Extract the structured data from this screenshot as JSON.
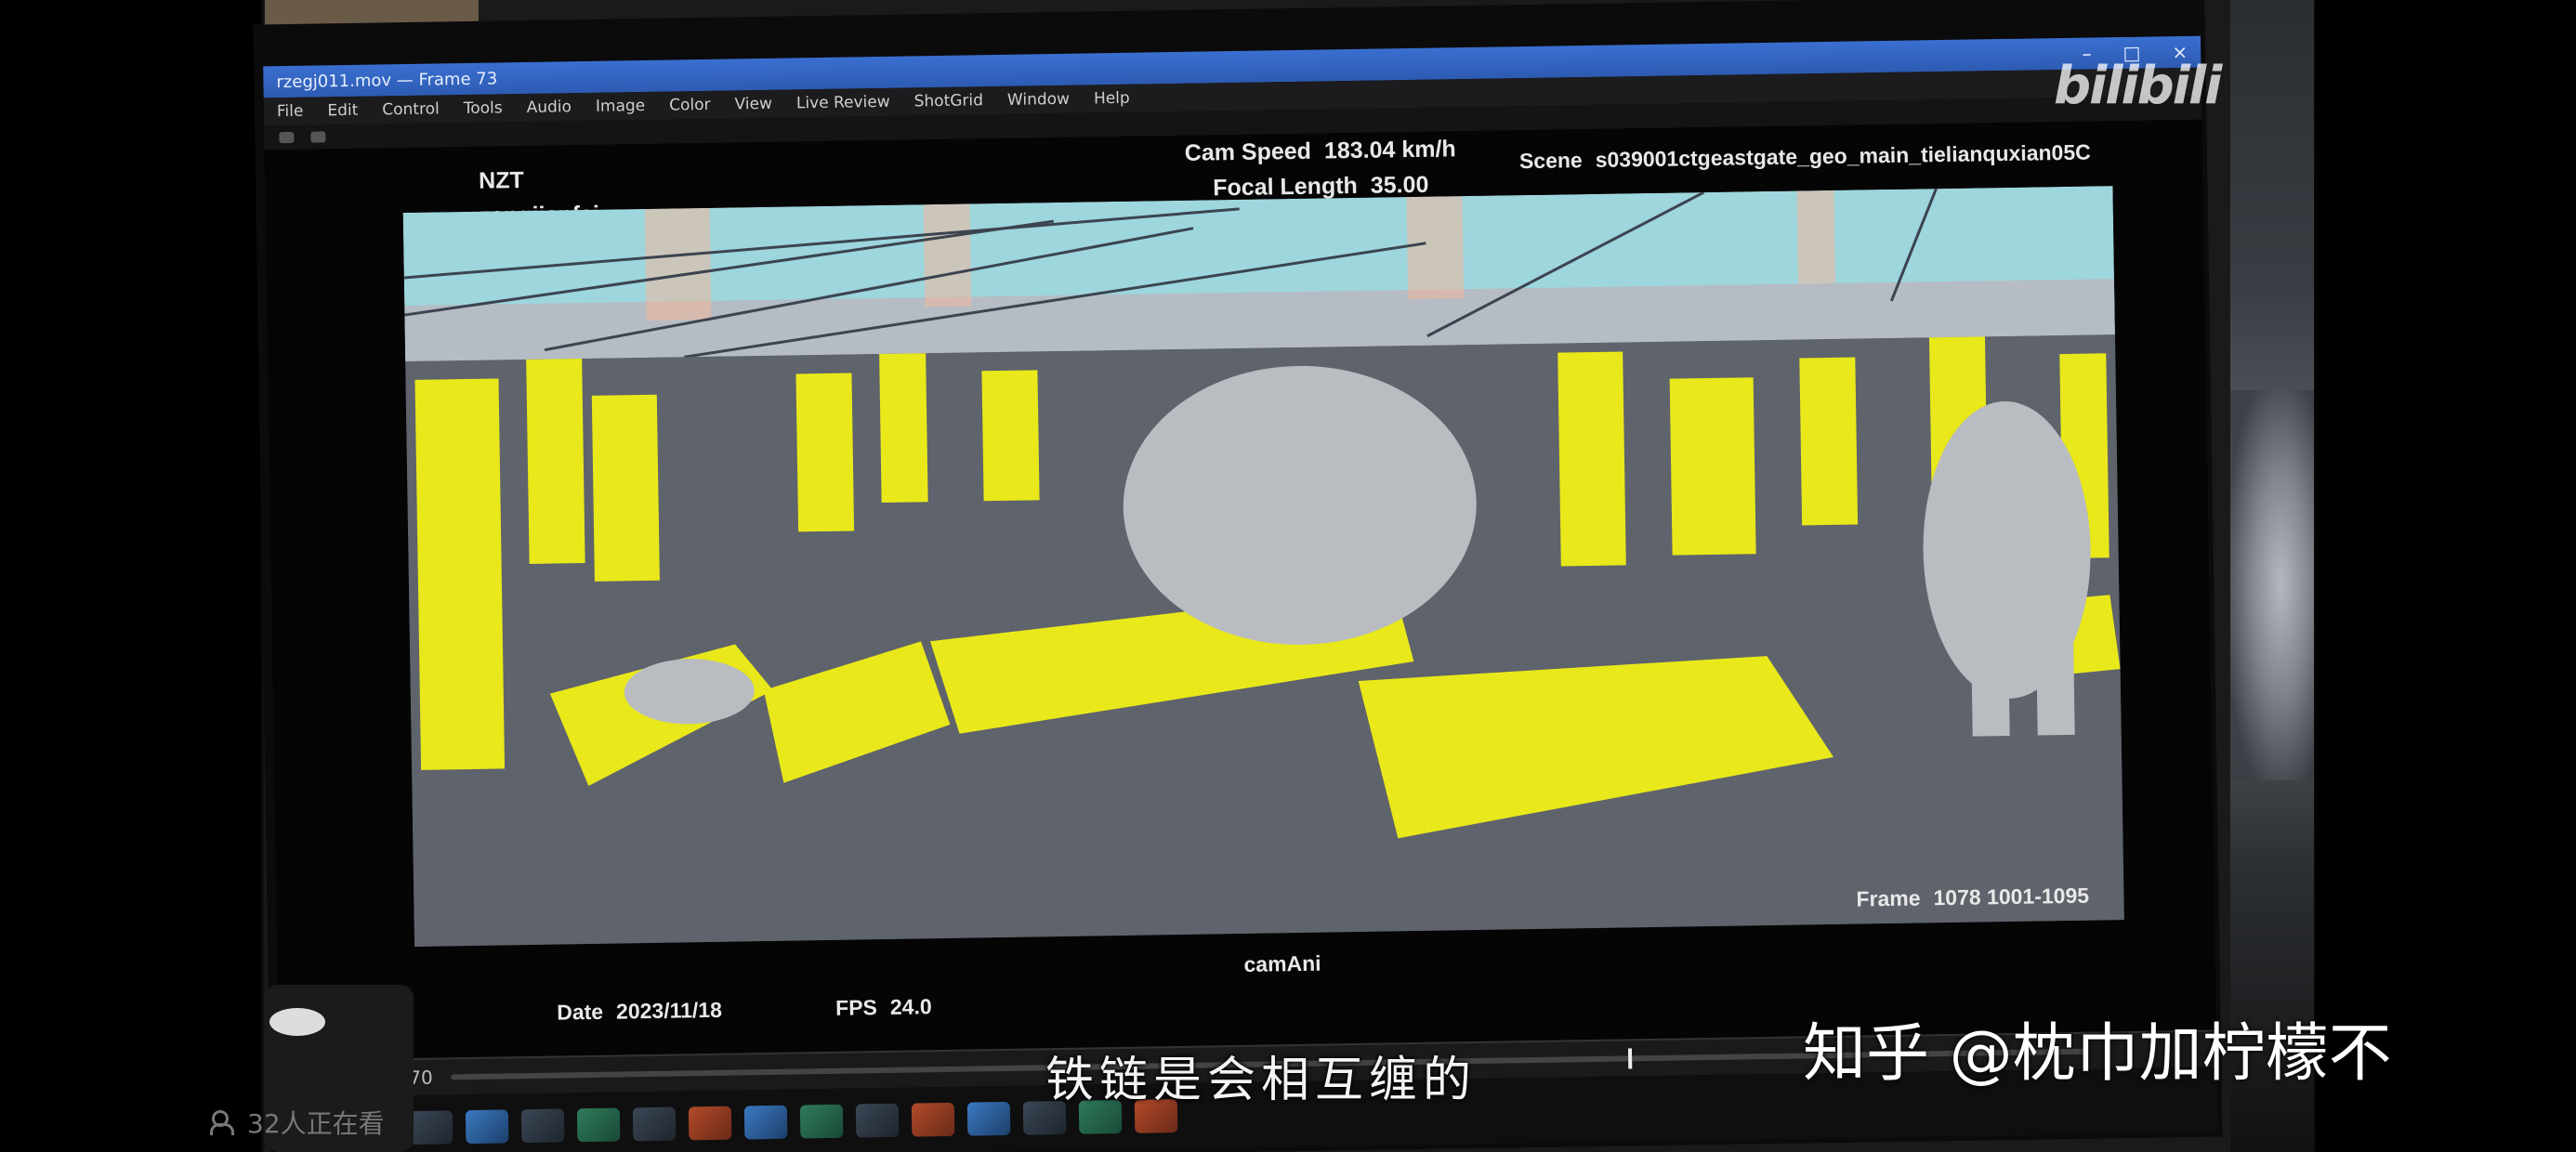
{
  "window": {
    "title": "rzegj011.mov — Frame 73",
    "controls": [
      "–",
      "□",
      "×"
    ]
  },
  "menu": [
    "File",
    "Edit",
    "Control",
    "Tools",
    "Audio",
    "Image",
    "Color",
    "View",
    "Live Review",
    "ShotGrid",
    "Window",
    "Help"
  ],
  "hud": {
    "studio": "NZT",
    "artist": "zengjianfei",
    "cam_speed_label": "Cam Speed",
    "cam_speed_value": "183.04 km/h",
    "focal_length_label": "Focal Length",
    "focal_length_value": "35.00",
    "scene_label": "Scene",
    "scene_value": "s039001ctgeastgate_geo_main_tielianquxian05C",
    "frame_label": "Frame",
    "frame_value": "1078  1001-1095",
    "camera_name": "camAni",
    "date_label": "Date",
    "date_value": "2023/11/18",
    "fps_label": "FPS",
    "fps_value": "24.0"
  },
  "timeline": {
    "start_frame": "70",
    "progress": 0.72
  },
  "overlays": {
    "bili_logo": "bilibili",
    "subtitle": "铁链是会相互缠的",
    "watermark": "知乎 @枕巾加柠檬不",
    "viewers": "32人正在看"
  },
  "colors": {
    "blocks": "#e9e81a",
    "sky": "#9ed6dd",
    "floor": "#5e636c",
    "characters": "#b9bcc1"
  }
}
